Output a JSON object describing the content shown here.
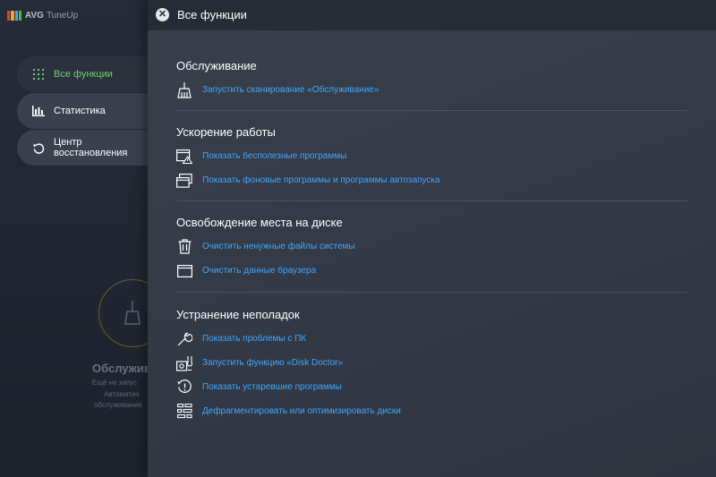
{
  "app": {
    "brand": "AVG",
    "product": "TuneUp",
    "logo_colors": [
      "#e1432b",
      "#f5a623",
      "#4aa3df",
      "#61b246"
    ]
  },
  "sidebar": {
    "items": [
      {
        "label": "Все функции",
        "icon": "grid-icon",
        "active": true
      },
      {
        "label": "Статистика",
        "icon": "bar-chart-icon",
        "active": false
      },
      {
        "label": "Центр восстановления",
        "icon": "restore-icon",
        "active": false
      }
    ]
  },
  "background": {
    "heading": "Обслужив",
    "line1": "Ещё не запус",
    "line2": "Автоматич",
    "line3": "обслуживания"
  },
  "panel": {
    "title": "Все функции",
    "sections": [
      {
        "title": "Обслуживание",
        "items": [
          {
            "label": "Запустить сканирование «Обслуживание»",
            "icon": "broom-icon"
          }
        ]
      },
      {
        "title": "Ускорение работы",
        "items": [
          {
            "label": "Показать бесполезные программы",
            "icon": "window-warning-icon"
          },
          {
            "label": "Показать фоновые программы и программы автозапуска",
            "icon": "windows-stack-icon"
          }
        ]
      },
      {
        "title": "Освобождение места на диске",
        "items": [
          {
            "label": "Очистить ненужные файлы системы",
            "icon": "trash-icon"
          },
          {
            "label": "Очистить данные браузера",
            "icon": "browser-window-icon"
          }
        ]
      },
      {
        "title": "Устранение неполадок",
        "items": [
          {
            "label": "Показать проблемы с ПК",
            "icon": "wrench-icon"
          },
          {
            "label": "Запустить функцию «Disk Doctor»",
            "icon": "disk-doctor-icon"
          },
          {
            "label": "Показать устаревшие программы",
            "icon": "outdated-clock-icon"
          },
          {
            "label": "Дефрагментировать или оптимизировать диски",
            "icon": "defrag-icon"
          }
        ]
      }
    ]
  },
  "colors": {
    "link": "#3ea7ff",
    "active_nav": "#6fd06f"
  }
}
